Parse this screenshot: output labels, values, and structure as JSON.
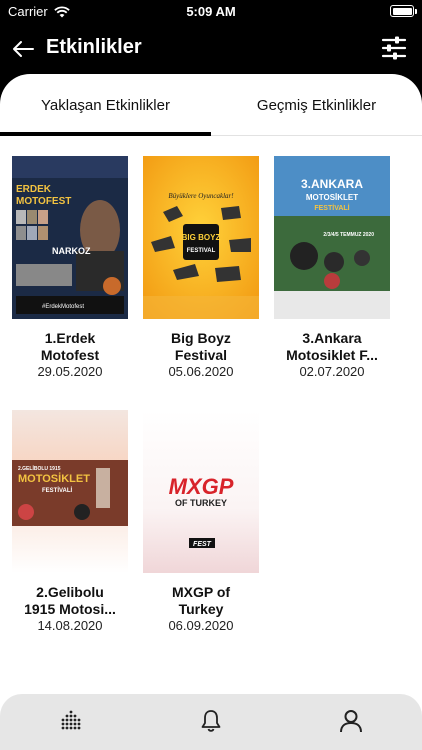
{
  "status": {
    "carrier": "Carrier",
    "time": "5:09 AM"
  },
  "nav": {
    "title": "Etkinlikler",
    "back_icon": "arrow-left-icon",
    "filter_icon": "sliders-icon"
  },
  "tabs": [
    {
      "label": "Yaklaşan Etkinlikler",
      "selected": true
    },
    {
      "label": "Geçmiş Etkinlikler",
      "selected": false
    }
  ],
  "events": [
    {
      "name_line1": "1.Erdek",
      "name_line2": "Motofest",
      "date": "29.05.2020",
      "poster": {
        "title_line1": "ERDEK",
        "title_line2": "MOTOFEST",
        "tag": "#ErdekMotofest",
        "label": "NARKOZ"
      }
    },
    {
      "name_line1": "Big Boyz",
      "name_line2": "Festival",
      "date": "05.06.2020",
      "poster": {
        "title_line1": "Büyüklere Oyuncaklar!",
        "title_line2": "BIG BOYZ",
        "sub": "FESTIVAL"
      }
    },
    {
      "name_line1": "3.Ankara",
      "name_line2": "Motosiklet F...",
      "date": "02.07.2020",
      "poster": {
        "title_line1": "3.ANKARA",
        "title_line2": "MOTOSİKLET",
        "title_line3": "FESTİVALİ",
        "sub": "2/3/4/5 TEMMUZ 2020"
      }
    },
    {
      "name_line1": "2.Gelibolu",
      "name_line2": "1915 Motosi...",
      "date": "14.08.2020",
      "poster": {
        "title_line1": "2.GELİBOLU 1915",
        "title_line2": "MOTOSİKLET",
        "sub": "FESTİVALİ"
      }
    },
    {
      "name_line1": "MXGP of",
      "name_line2": "Turkey",
      "date": "06.09.2020",
      "poster": {
        "title_line1": "MXGP",
        "title_line2": "OF TURKEY",
        "sub": "FEST"
      }
    }
  ],
  "bottom_nav": [
    {
      "icon": "grid-dots-icon"
    },
    {
      "icon": "bell-icon"
    },
    {
      "icon": "user-icon"
    }
  ],
  "colors": {
    "header_bg": "#000000",
    "sheet_bg": "#ffffff",
    "bottom_bar_bg": "#e6e6e6"
  }
}
